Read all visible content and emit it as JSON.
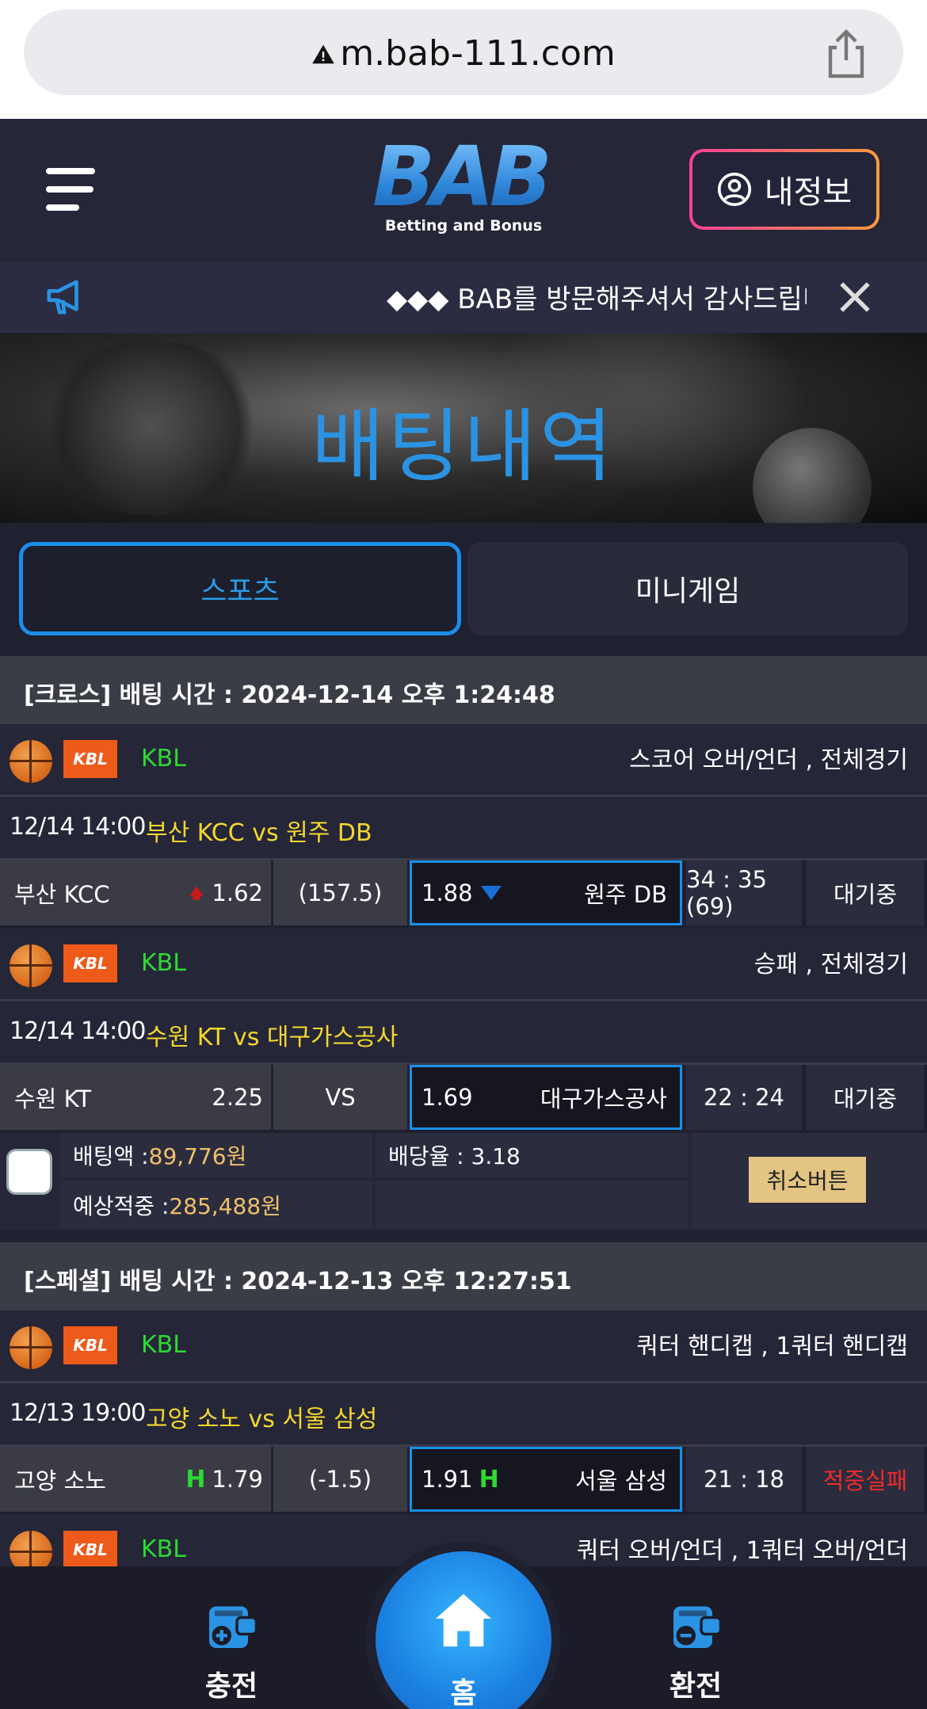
{
  "browser": {
    "url": "m.bab-111.com"
  },
  "header": {
    "logo_text": "BAB",
    "logo_sub": "Betting and Bonus",
    "myinfo_label": "내정보"
  },
  "notice": {
    "text": "◆◆◆ BAB를 방문해주셔서 감사드립니다"
  },
  "banner": {
    "title": "배팅내역"
  },
  "tabs": [
    {
      "label": "스포츠",
      "active": true
    },
    {
      "label": "미니게임",
      "active": false
    }
  ],
  "bets": [
    {
      "header": "[크로스] 배팅 시간 : 2024-12-14 오후 1:24:48",
      "games": [
        {
          "league": "KBL",
          "market": "스코어 오버/언더 , 전체경기",
          "time": "12/14 14:00",
          "teams": "부산 KCC  vs  원주 DB",
          "home": "부산 KCC",
          "home_odds": "1.62",
          "line": "(157.5)",
          "away": "원주 DB",
          "away_odds": "1.88",
          "score": "34 : 35 (69)",
          "status": "대기중"
        },
        {
          "league": "KBL",
          "market": "승패 , 전체경기",
          "time": "12/14 14:00",
          "teams": "수원 KT  vs  대구가스공사",
          "home": "수원 KT",
          "home_odds": "2.25",
          "line": "VS",
          "away": "대구가스공사",
          "away_odds": "1.69",
          "score": "22 : 24",
          "status": "대기중"
        }
      ],
      "summary": {
        "bet_amount_label": "배팅액 : ",
        "bet_amount": "89,776원",
        "rate": "배당율 : 3.18",
        "expected_label": "예상적중 : ",
        "expected": "285,488원",
        "cancel_label": "취소버튼"
      }
    },
    {
      "header": "[스페셜] 배팅 시간 : 2024-12-13 오후 12:27:51",
      "games": [
        {
          "league": "KBL",
          "market": "쿼터 핸디캡 , 1쿼터 핸디캡",
          "time": "12/13 19:00",
          "teams": "고양 소노  vs  서울 삼성",
          "home": "고양 소노",
          "home_odds": "1.79",
          "line": "(-1.5)",
          "away": "서울 삼성",
          "away_odds": "1.91",
          "score": "21 : 18",
          "status": "적중실패"
        },
        {
          "league": "KBL",
          "market": "쿼터 오버/언더 , 1쿼터 오버/언더"
        }
      ]
    }
  ],
  "bottom_nav": {
    "deposit": "충전",
    "home": "홈",
    "withdraw": "환전"
  },
  "colors": {
    "accent_blue": "#1a8fe8",
    "league_green": "#2dd934",
    "teams_yellow": "#f5d72d",
    "fail_red": "#f02a2a",
    "amount_gold": "#f0c06a"
  }
}
